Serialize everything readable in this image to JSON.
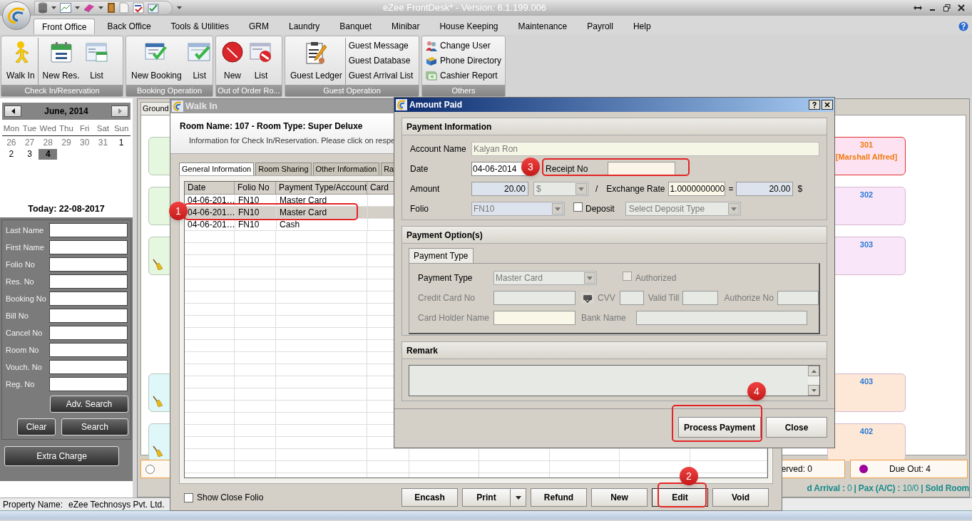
{
  "window": {
    "title": "eZee FrontDesk* - Version: 6.1.199.006"
  },
  "menu_tabs": [
    {
      "label": "Front Office",
      "selected": true
    },
    {
      "label": "Back Office",
      "selected": false
    },
    {
      "label": "Tools & Utilities",
      "selected": false
    },
    {
      "label": "GRM",
      "selected": false
    },
    {
      "label": "Laundry",
      "selected": false
    },
    {
      "label": "Banquet",
      "selected": false
    },
    {
      "label": "Minibar",
      "selected": false
    },
    {
      "label": "House Keeping",
      "selected": false
    },
    {
      "label": "Maintenance",
      "selected": false
    },
    {
      "label": "Payroll",
      "selected": false
    },
    {
      "label": "Help",
      "selected": false
    }
  ],
  "ribbon": [
    {
      "title": "Check In/Reservation",
      "items": [
        {
          "label": "Walk In",
          "kind": "walker",
          "separator_after": true
        },
        {
          "label": "New Res.",
          "kind": "calendar",
          "separator_after": false
        },
        {
          "label": "List",
          "kind": "calendarlist",
          "separator_after": false
        }
      ]
    },
    {
      "title": "Booking Operation",
      "items": [
        {
          "label": "New Booking",
          "kind": "booking",
          "separator_after": false
        },
        {
          "label": "List",
          "kind": "bookinglist",
          "separator_after": false
        }
      ]
    },
    {
      "title": "Out of Order Ro...",
      "items": [
        {
          "label": "New",
          "kind": "noentry",
          "separator_after": false
        },
        {
          "label": "List",
          "kind": "noentrylist",
          "separator_after": false
        }
      ]
    },
    {
      "title": "Guest Operation",
      "items": [
        {
          "label": "Guest Ledger",
          "kind": "ledger",
          "separator_after": true
        },
        {
          "label": "Guest Message",
          "kind": "link",
          "separator_after": false
        },
        {
          "label": "Guest Database",
          "kind": "link",
          "separator_after": false
        },
        {
          "label": "Guest Arrival List",
          "kind": "link",
          "separator_after": false
        }
      ]
    },
    {
      "title": "Others",
      "items": [
        {
          "label": "Change User",
          "kind": "user",
          "separator_after": false
        },
        {
          "label": "Phone Directory",
          "kind": "phone",
          "separator_after": false
        },
        {
          "label": "Cashier Report",
          "kind": "cash",
          "separator_after": false
        }
      ]
    }
  ],
  "calendar": {
    "month": "June, 2014",
    "weekdays": [
      "Mon",
      "Tue",
      "Wed",
      "Thu",
      "Fri",
      "Sat",
      "Sun"
    ],
    "days": [
      {
        "day": "26",
        "in_month": false,
        "selected": false
      },
      {
        "day": "27",
        "in_month": false,
        "selected": false
      },
      {
        "day": "28",
        "in_month": false,
        "selected": false
      },
      {
        "day": "29",
        "in_month": false,
        "selected": false
      },
      {
        "day": "30",
        "in_month": false,
        "selected": false
      },
      {
        "day": "31",
        "in_month": false,
        "selected": false
      },
      {
        "day": "1",
        "in_month": true,
        "selected": false
      },
      {
        "day": "2",
        "in_month": true,
        "selected": false
      },
      {
        "day": "3",
        "in_month": true,
        "selected": false
      },
      {
        "day": "4",
        "in_month": true,
        "selected": true
      }
    ],
    "today": "Today: 22-08-2017"
  },
  "search": {
    "fields": [
      "Last Name",
      "First Name",
      "Folio No",
      "Res. No",
      "Booking No",
      "Bill No",
      "Cancel No",
      "Room No",
      "Vouch. No",
      "Reg. No"
    ],
    "adv_button": "Adv. Search",
    "clear_button": "Clear",
    "search_button": "Search",
    "extra_button": "Extra Charge"
  },
  "rooms": {
    "floor_tab": "Ground",
    "groups": [
      {
        "left": [
          {
            "color": "#e6f7e0",
            "dirty": false
          },
          {
            "color": "#e6f7e0",
            "dirty": false
          },
          {
            "color": "#e6f7e0",
            "dirty": true
          }
        ],
        "right": [
          {
            "number": "301",
            "guest": "[Marshall Alfred]",
            "color": "#fde3f1"
          },
          {
            "number": "302",
            "color": "#f9e6f8"
          },
          {
            "number": "303",
            "color": "#f9e6f8"
          }
        ]
      },
      {
        "left": [
          {
            "color": "#dff7f8",
            "dirty": true
          },
          {
            "color": "#dff7f8",
            "dirty": true
          }
        ],
        "right": [
          {
            "number": "403",
            "color": "#fde7d6"
          },
          {
            "number": "402",
            "color": "#fde7d6"
          }
        ]
      }
    ],
    "radio": {
      "checked": false
    },
    "counters": [
      {
        "label": "erved: 0"
      },
      {
        "label": "Due Out: 4",
        "color": "#a0009c"
      }
    ],
    "summary": "**d Arrival :** 0 **| Pax (A/C) :** 10/0 **| Sold Room**"
  },
  "status_bar": {
    "property_label": "Property Name:",
    "property_value": "eZee Technosys Pvt. Ltd."
  },
  "walk_in": {
    "title": "Walk In",
    "heading": "Room Name: 107 - Room Type: Super Deluxe",
    "info": "Information for Check In/Reservation. Please click on respe",
    "tabs": [
      {
        "label": "General Information",
        "selected": true
      },
      {
        "label": "Room Sharing",
        "selected": false
      },
      {
        "label": "Other Information",
        "selected": false
      },
      {
        "label": "Ra",
        "selected": false
      }
    ],
    "columns": [
      "Date",
      "Folio No",
      "Payment Type/Account",
      "Card"
    ],
    "rows": [
      {
        "cells": [
          "04-06-201…",
          "FN10",
          "Master Card"
        ],
        "selected": false
      },
      {
        "cells": [
          "04-06-201…",
          "FN10",
          "Master Card"
        ],
        "selected": true
      },
      {
        "cells": [
          "04-06-201…",
          "FN10",
          "Cash"
        ],
        "selected": false
      }
    ],
    "show_close_folio": {
      "label": "Show Close Folio",
      "checked": false
    },
    "buttons": [
      {
        "label": "Encash",
        "dropdown": false
      },
      {
        "label": "Print",
        "dropdown": true
      },
      {
        "label": "Refund",
        "dropdown": false
      },
      {
        "label": "New",
        "dropdown": false
      },
      {
        "label": "Edit",
        "dropdown": false
      },
      {
        "label": "Void",
        "dropdown": false
      }
    ]
  },
  "amount_paid": {
    "title": "Amount Paid",
    "payment_information": {
      "title": "Payment Information",
      "account_name": {
        "label": "Account Name",
        "value": "Kalyan Ron"
      },
      "date": {
        "label": "Date",
        "value": "04-06-2014"
      },
      "receipt_no": {
        "label": "Receipt No"
      },
      "amount": {
        "label": "Amount",
        "value": "20.00",
        "currency": "$",
        "slash": "/",
        "exchange_label": "Exchange Rate",
        "exchange_rate": "1.0000000000",
        "equals": "=",
        "converted": "20.00",
        "converted_currency": "$"
      },
      "folio": {
        "label": "Folio",
        "value": "FN10"
      },
      "deposit": {
        "label": "Deposit",
        "checked": false
      },
      "deposit_type": {
        "value": "Select Deposit Type"
      }
    },
    "payment_options": {
      "title": "Payment Option(s)",
      "tab": "Payment Type",
      "payment_type": {
        "label": "Payment Type",
        "value": "Master Card"
      },
      "authorized": {
        "label": "Authorized",
        "checked": false
      },
      "credit_card_no": "Credit Card No",
      "cvv": "CVV",
      "valid_till": "Valid Till",
      "authorize_no": "Authorize No",
      "card_holder_name": "Card Holder Name",
      "bank_name": "Bank Name"
    },
    "remark": {
      "title": "Remark"
    },
    "buttons": [
      "Process Payment",
      "Close"
    ]
  },
  "annotations": [
    {
      "number": "1"
    },
    {
      "number": "2"
    },
    {
      "number": "3"
    },
    {
      "number": "4"
    }
  ]
}
